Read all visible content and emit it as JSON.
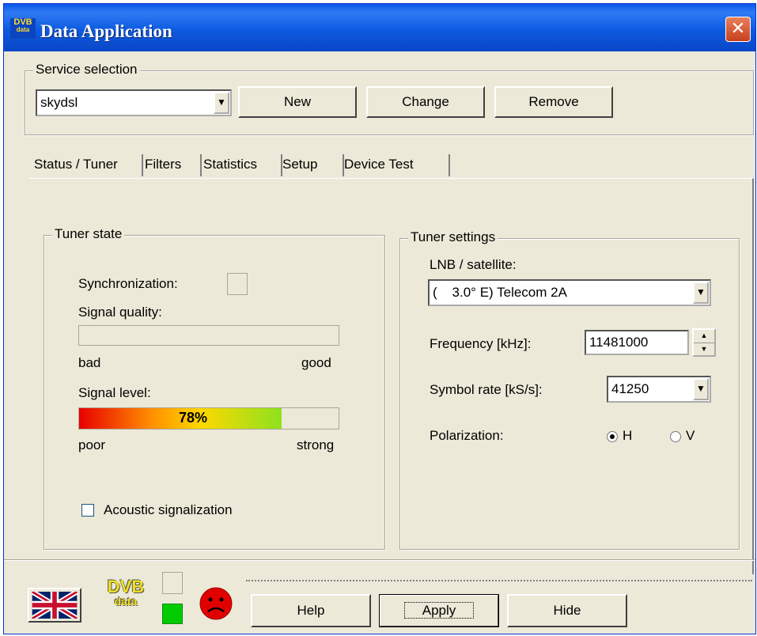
{
  "window": {
    "title": "Data Application",
    "icon_top": "DVB",
    "icon_bottom": "data"
  },
  "service": {
    "group_label": "Service selection",
    "selected": "skydsl",
    "new_label": "New",
    "change_label": "Change",
    "remove_label": "Remove"
  },
  "tabs": [
    "Status / Tuner",
    "Filters",
    "Statistics",
    "Setup",
    "Device Test"
  ],
  "tuner_state": {
    "group_label": "Tuner state",
    "sync_label": "Synchronization:",
    "quality_label": "Signal quality:",
    "quality_low": "bad",
    "quality_high": "good",
    "level_label": "Signal level:",
    "level_value_text": "78%",
    "level_fraction": 0.78,
    "level_low": "poor",
    "level_high": "strong",
    "acoustic_label": "Acoustic signalization"
  },
  "tuner_settings": {
    "group_label": "Tuner settings",
    "lnb_label": "LNB / satellite:",
    "lnb_value": "(    3.0° E) Telecom 2A",
    "frequency_label": "Frequency [kHz]:",
    "frequency_value": "11481000",
    "symbol_label": "Symbol rate [kS/s]:",
    "symbol_value": "41250",
    "polarization_label": "Polarization:",
    "pol_h": "H",
    "pol_v": "V"
  },
  "footer": {
    "logo_top": "DVB",
    "logo_bottom": "data",
    "help_label": "Help",
    "apply_label": "Apply",
    "hide_label": "Hide"
  },
  "colors": {
    "title_bar": "#0a58e8",
    "status_green": "#00cc00",
    "status_face": "#e00000",
    "logo_yellow": "#f0e020"
  }
}
